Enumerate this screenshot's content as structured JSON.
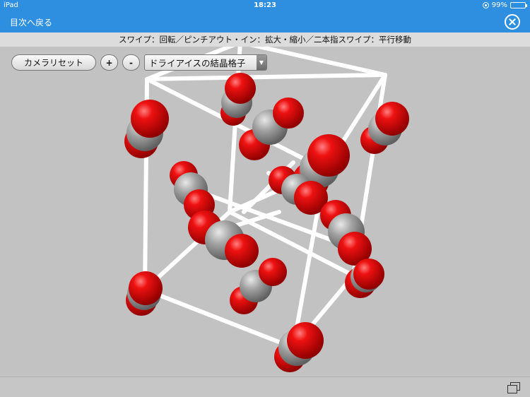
{
  "status_bar": {
    "device": "iPad",
    "time": "18:23",
    "battery": "99%"
  },
  "nav": {
    "back_label": "目次へ戻る"
  },
  "hint": "スワイプ：回転／ピンチアウト・イン：拡大・縮小／二本指スワイプ：平行移動",
  "toolbar": {
    "reset_label": "カメラリセット",
    "zoom_in_label": "+",
    "zoom_out_label": "-",
    "model_selected": "ドライアイスの結晶格子"
  },
  "colors": {
    "header": "#2e8fe0",
    "oxygen": "#ee1111",
    "carbon": "#a0a0a0",
    "bond_lines": "#ffffff",
    "viewer_bg": "#c2c2c2"
  },
  "icons": {
    "close": "close-icon",
    "window": "window-switch-icon",
    "dropdown": "chevron-down-icon"
  }
}
